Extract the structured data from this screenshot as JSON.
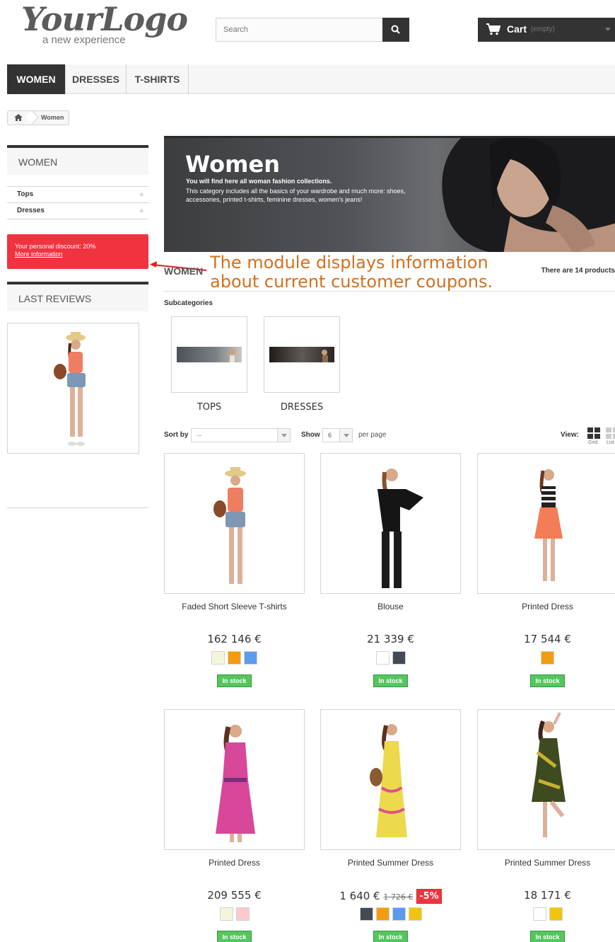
{
  "header": {
    "logo_main": "YourLogo",
    "logo_sub": "a new experience",
    "search_placeholder": "Search",
    "cart_label": "Cart",
    "cart_status": "(empty)"
  },
  "nav": [
    "WOMEN",
    "DRESSES",
    "T-SHIRTS"
  ],
  "breadcrumb": {
    "current": "Women"
  },
  "sidebar": {
    "category_title": "WOMEN",
    "categories": [
      "Tops",
      "Dresses"
    ],
    "discount_text": "Your personal discount: 20%",
    "discount_link": "More information",
    "reviews_title": "LAST REVIEWS"
  },
  "banner": {
    "title": "Women",
    "line1": "You will find here all woman fashion collections.",
    "line2": "This category includes all the basics of your wardrobe and much more: shoes, accessories, printed t-shirts, feminine dresses, women's jeans!"
  },
  "category": {
    "heading": "WOMEN",
    "product_count": "There are 14 products",
    "annotation_line1": "The module displays information",
    "annotation_line2": "about current customer coupons.",
    "subcategories_title": "Subcategories",
    "subcategories": [
      "TOPS",
      "DRESSES"
    ]
  },
  "toolbar": {
    "sort_label": "Sort by",
    "sort_value": "--",
    "show_label": "Show",
    "show_value": "6",
    "per_page": "per page",
    "view_label": "View:",
    "grid_label": "Grid",
    "list_label": "List"
  },
  "products": [
    {
      "name": "Faded Short Sleeve T-shirts",
      "price": "162 146 €",
      "old_price": "",
      "reduction": "",
      "stock": "In stock",
      "colors": [
        "#f5f5dc",
        "#f39c11",
        "#5d9cec"
      ]
    },
    {
      "name": "Blouse",
      "price": "21 339 €",
      "old_price": "",
      "reduction": "",
      "stock": "In stock",
      "colors": [
        "#ffffff",
        "#434a54"
      ]
    },
    {
      "name": "Printed Dress",
      "price": "17 544 €",
      "old_price": "",
      "reduction": "",
      "stock": "In stock",
      "colors": [
        "#f39c11"
      ]
    },
    {
      "name": "Printed Dress",
      "price": "209 555 €",
      "old_price": "",
      "reduction": "",
      "stock": "In stock",
      "colors": [
        "#f5f5dc",
        "#fccacd"
      ]
    },
    {
      "name": "Printed Summer Dress",
      "price": "1 640 €",
      "old_price": "1 726 €",
      "reduction": "-5%",
      "stock": "In stock",
      "colors": [
        "#434a54",
        "#f39c11",
        "#5d9cec",
        "#f1c40f"
      ]
    },
    {
      "name": "Printed Summer Dress",
      "price": "18 171 €",
      "old_price": "",
      "reduction": "",
      "stock": "In stock",
      "colors": [
        "#ffffff",
        "#f1c40f"
      ]
    }
  ]
}
